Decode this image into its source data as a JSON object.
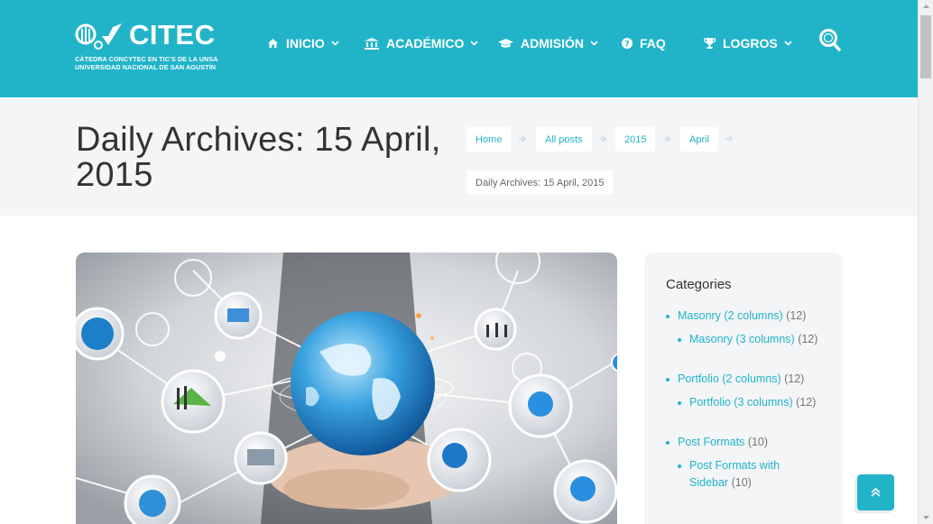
{
  "logo": {
    "word": "CITEC",
    "line1": "CÁTEDRA CONCYTEC EN TIC'S DE LA UNSA",
    "line2": "UNIVERSIDAD NACIONAL DE SAN AGUSTÍN"
  },
  "nav": {
    "items": [
      {
        "label": "INICIO",
        "icon": "home-icon",
        "dropdown": true
      },
      {
        "label": "ACADÉMICO",
        "icon": "bank-icon",
        "dropdown": true
      },
      {
        "label": "ADMISIÓN",
        "icon": "graduation-cap-icon",
        "dropdown": true
      },
      {
        "label": "FAQ",
        "icon": "question-circle-icon",
        "dropdown": false
      },
      {
        "label": "LOGROS",
        "icon": "trophy-icon",
        "dropdown": true
      }
    ],
    "search_icon": "search-icon"
  },
  "page": {
    "title": "Daily Archives: 15 April, 2015"
  },
  "breadcrumb": [
    {
      "label": "Home"
    },
    {
      "label": "All posts"
    },
    {
      "label": "2015"
    },
    {
      "label": "April"
    },
    {
      "label": "Daily Archives: 15 April, 2015"
    }
  ],
  "sidebar": {
    "title": "Categories",
    "items": [
      {
        "label": "Masonry (2 columns)",
        "count": "(12)",
        "level": 1
      },
      {
        "label": "Masonry (3 columns)",
        "count": "(12)",
        "level": 2
      },
      {
        "label": "Portfolio (2 columns)",
        "count": "(12)",
        "level": 1
      },
      {
        "label": "Portfolio (3 columns)",
        "count": "(12)",
        "level": 2
      },
      {
        "label": "Post Formats",
        "count": "(10)",
        "level": 1
      },
      {
        "label": "Post Formats with Sidebar",
        "count": "(10)",
        "level": 2
      }
    ]
  },
  "colors": {
    "accent": "#21b4c9",
    "band": "#f3f5f7",
    "text": "#333333"
  }
}
